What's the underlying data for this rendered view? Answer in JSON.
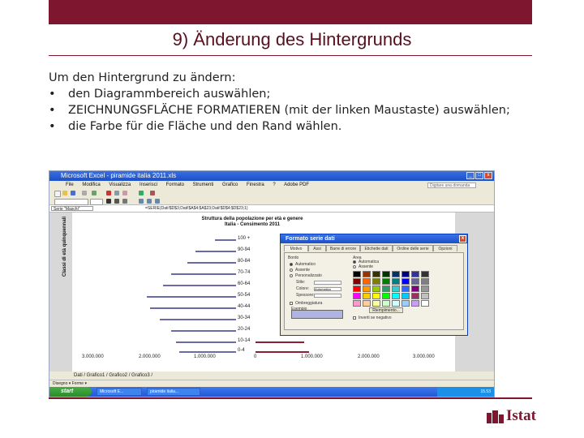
{
  "slide": {
    "title": "9) Änderung des Hintergrunds",
    "intro": "Um den Hintergrund zu ändern:",
    "bullets": [
      "den Diagrammbereich auswählen;",
      "ZEICHNUNGSFLÄCHE FORMATIEREN (mit der linken Maustaste) auswählen;",
      "die Farbe für die Fläche und den Rand wählen."
    ],
    "logo": "Istat"
  },
  "colors": {
    "brand": "#7e1630",
    "xp_blue": "#1b4fc8",
    "male_bars": "#6a6aa8",
    "female_bars": "#8b2030"
  },
  "screenshot": {
    "window_title": "Microsoft Excel - piramide italia 2011.xls",
    "menu": [
      "File",
      "Modifica",
      "Visualizza",
      "Inserisci",
      "Formato",
      "Strumenti",
      "Grafico",
      "Finestra",
      "?",
      "Adobe PDF"
    ],
    "help_placeholder": "Digitare una domanda",
    "namebox": "Serie \"Maschi\"",
    "formula": "=SERIE(Dati!$D$3;Dati!$A$4:$A$23;Dati!$D$4:$D$23;1)",
    "chart_title_line1": "Struttura della popolazione per età e genere",
    "chart_title_line2": "Italia - Censimento 2011",
    "y_axis_label": "Classi di età quinquennali",
    "age_labels": [
      "100 +",
      "90-94",
      "80-84",
      "70-74",
      "60-64",
      "50-54",
      "40-44",
      "30-34",
      "20-24",
      "10-14",
      "0-4"
    ],
    "x_ticks": [
      "3.000.000",
      "2.000.000",
      "1.000.000",
      "0",
      "1.000.000",
      "2.000.000",
      "3.000.000"
    ],
    "dialog": {
      "title": "Formato serie dati",
      "tabs": [
        "Motivo",
        "Assi",
        "Barre di errore",
        "Etichette dati",
        "Ordine delle serie",
        "Opzioni"
      ],
      "border_group": "Bordo",
      "border_options": [
        "Automatico",
        "Assente",
        "Personalizzato"
      ],
      "border_fields": [
        "Stile:",
        "Colore:",
        "Spessore:"
      ],
      "border_color_value": "Automatico",
      "shadow_label": "Ombreggiatura",
      "area_group": "Area",
      "area_options": [
        "Automatica",
        "Assente"
      ],
      "effects_button": "Riempimento...",
      "invert_label": "Inverti se negativo",
      "sample_label": "Esempio"
    },
    "sheet_tabs": "Dati / Grafico1 / Grafico2 / Grafico3 /",
    "draw_bar": "Disegno ▾   Forme ▾",
    "start_label": "start",
    "tasks": [
      "Microsoft E...",
      "piramide italia..."
    ],
    "clock": "15.53"
  }
}
